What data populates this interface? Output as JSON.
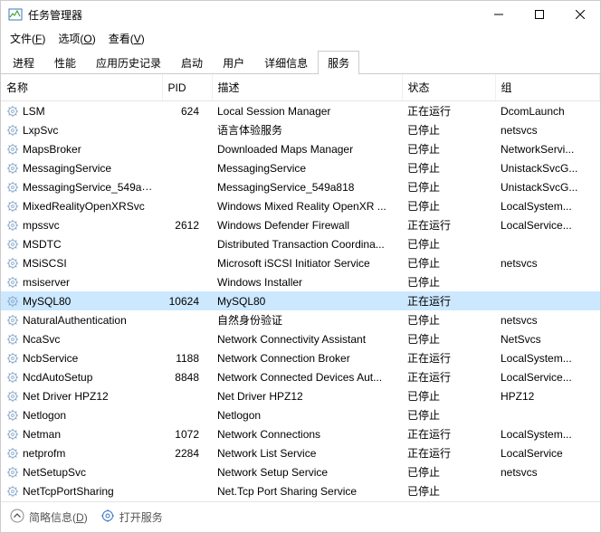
{
  "window": {
    "title": "任务管理器"
  },
  "menu": {
    "file": {
      "label": "文件",
      "accel": "F"
    },
    "options": {
      "label": "选项",
      "accel": "O"
    },
    "view": {
      "label": "查看",
      "accel": "V"
    }
  },
  "tabs": [
    {
      "label": "进程"
    },
    {
      "label": "性能"
    },
    {
      "label": "应用历史记录"
    },
    {
      "label": "启动"
    },
    {
      "label": "用户"
    },
    {
      "label": "详细信息"
    },
    {
      "label": "服务"
    }
  ],
  "active_tab": 6,
  "columns": {
    "name": "名称",
    "pid": "PID",
    "desc": "描述",
    "status": "状态",
    "group": "组"
  },
  "status_labels": {
    "running": "正在运行",
    "stopped": "已停止"
  },
  "services": [
    {
      "name": "LSM",
      "pid": "624",
      "desc": "Local Session Manager",
      "status": "running",
      "group": "DcomLaunch"
    },
    {
      "name": "LxpSvc",
      "pid": "",
      "desc": "语言体验服务",
      "status": "stopped",
      "group": "netsvcs"
    },
    {
      "name": "MapsBroker",
      "pid": "",
      "desc": "Downloaded Maps Manager",
      "status": "stopped",
      "group": "NetworkServi..."
    },
    {
      "name": "MessagingService",
      "pid": "",
      "desc": "MessagingService",
      "status": "stopped",
      "group": "UnistackSvcG..."
    },
    {
      "name": "MessagingService_549a8...",
      "pid": "",
      "desc": "MessagingService_549a818",
      "status": "stopped",
      "group": "UnistackSvcG..."
    },
    {
      "name": "MixedRealityOpenXRSvc",
      "pid": "",
      "desc": "Windows Mixed Reality OpenXR ...",
      "status": "stopped",
      "group": "LocalSystem..."
    },
    {
      "name": "mpssvc",
      "pid": "2612",
      "desc": "Windows Defender Firewall",
      "status": "running",
      "group": "LocalService..."
    },
    {
      "name": "MSDTC",
      "pid": "",
      "desc": "Distributed Transaction Coordina...",
      "status": "stopped",
      "group": ""
    },
    {
      "name": "MSiSCSI",
      "pid": "",
      "desc": "Microsoft iSCSI Initiator Service",
      "status": "stopped",
      "group": "netsvcs"
    },
    {
      "name": "msiserver",
      "pid": "",
      "desc": "Windows Installer",
      "status": "stopped",
      "group": ""
    },
    {
      "name": "MySQL80",
      "pid": "10624",
      "desc": "MySQL80",
      "status": "running",
      "group": "",
      "selected": true
    },
    {
      "name": "NaturalAuthentication",
      "pid": "",
      "desc": "自然身份验证",
      "status": "stopped",
      "group": "netsvcs"
    },
    {
      "name": "NcaSvc",
      "pid": "",
      "desc": "Network Connectivity Assistant",
      "status": "stopped",
      "group": "NetSvcs"
    },
    {
      "name": "NcbService",
      "pid": "1188",
      "desc": "Network Connection Broker",
      "status": "running",
      "group": "LocalSystem..."
    },
    {
      "name": "NcdAutoSetup",
      "pid": "8848",
      "desc": "Network Connected Devices Aut...",
      "status": "running",
      "group": "LocalService..."
    },
    {
      "name": "Net Driver HPZ12",
      "pid": "",
      "desc": "Net Driver HPZ12",
      "status": "stopped",
      "group": "HPZ12"
    },
    {
      "name": "Netlogon",
      "pid": "",
      "desc": "Netlogon",
      "status": "stopped",
      "group": ""
    },
    {
      "name": "Netman",
      "pid": "1072",
      "desc": "Network Connections",
      "status": "running",
      "group": "LocalSystem..."
    },
    {
      "name": "netprofm",
      "pid": "2284",
      "desc": "Network List Service",
      "status": "running",
      "group": "LocalService"
    },
    {
      "name": "NetSetupSvc",
      "pid": "",
      "desc": "Network Setup Service",
      "status": "stopped",
      "group": "netsvcs"
    },
    {
      "name": "NetTcpPortSharing",
      "pid": "",
      "desc": "Net.Tcp Port Sharing Service",
      "status": "stopped",
      "group": ""
    }
  ],
  "footer": {
    "fewer": {
      "label": "简略信息",
      "accel": "D"
    },
    "open_services": "打开服务"
  }
}
